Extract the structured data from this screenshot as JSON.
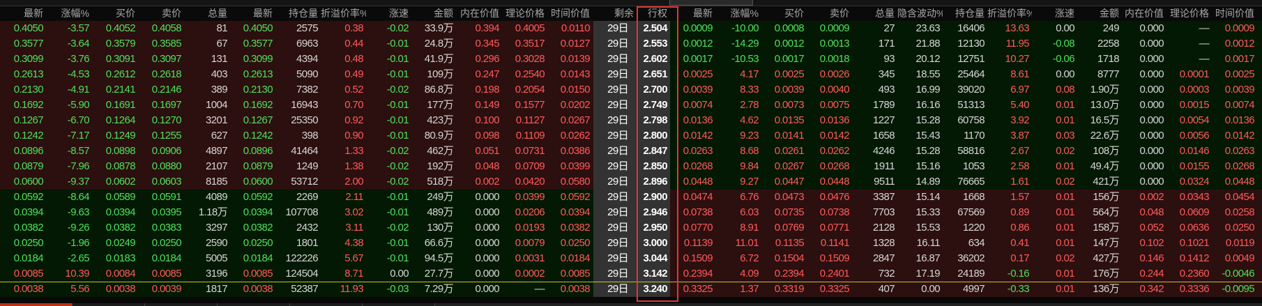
{
  "headers": {
    "call": [
      "最新",
      "涨幅%",
      "买价",
      "卖价",
      "总量",
      "最新",
      "持仓量",
      "折溢价率%",
      "涨速",
      "金额",
      "内在价值",
      "理论价格",
      "时间价值"
    ],
    "remaining": "剩余",
    "strike": "行权",
    "put": [
      "最新",
      "涨幅%",
      "买价",
      "卖价",
      "总量",
      "隐含波动%",
      "持仓量",
      "折溢价率%",
      "涨速",
      "金额",
      "内在价值",
      "理论价格",
      "时间价值"
    ]
  },
  "rows": [
    {
      "strike": "2.504",
      "days": "29日",
      "call": [
        "0.4050",
        "-3.57",
        "0.4052",
        "0.4058",
        "81",
        "0.4050",
        "2575",
        "0.38",
        "-0.02",
        "33.9万",
        "0.394",
        "0.4005",
        "0.0110"
      ],
      "put": [
        "0.0009",
        "-10.00",
        "0.0008",
        "0.0009",
        "27",
        "23.63",
        "16406",
        "13.63",
        "0.00",
        "249",
        "0.000",
        "—",
        "0.0009"
      ]
    },
    {
      "strike": "2.553",
      "days": "29日",
      "call": [
        "0.3577",
        "-3.64",
        "0.3579",
        "0.3585",
        "67",
        "0.3577",
        "6963",
        "0.44",
        "-0.01",
        "24.8万",
        "0.345",
        "0.3517",
        "0.0127"
      ],
      "put": [
        "0.0012",
        "-14.29",
        "0.0012",
        "0.0013",
        "171",
        "21.88",
        "12130",
        "11.95",
        "-0.08",
        "2258",
        "0.000",
        "—",
        "0.0012"
      ]
    },
    {
      "strike": "2.602",
      "days": "29日",
      "call": [
        "0.3099",
        "-3.76",
        "0.3091",
        "0.3097",
        "131",
        "0.3099",
        "4394",
        "0.48",
        "-0.01",
        "41.9万",
        "0.296",
        "0.3028",
        "0.0139"
      ],
      "put": [
        "0.0017",
        "-10.53",
        "0.0017",
        "0.0018",
        "93",
        "20.12",
        "12751",
        "10.27",
        "-0.06",
        "1718",
        "0.000",
        "—",
        "0.0017"
      ]
    },
    {
      "strike": "2.651",
      "days": "29日",
      "call": [
        "0.2613",
        "-4.53",
        "0.2612",
        "0.2618",
        "403",
        "0.2613",
        "5090",
        "0.49",
        "-0.01",
        "109万",
        "0.247",
        "0.2540",
        "0.0143"
      ],
      "put": [
        "0.0025",
        "4.17",
        "0.0025",
        "0.0026",
        "345",
        "18.55",
        "25464",
        "8.61",
        "0.00",
        "8777",
        "0.000",
        "0.0001",
        "0.0025"
      ]
    },
    {
      "strike": "2.700",
      "days": "29日",
      "call": [
        "0.2130",
        "-4.91",
        "0.2141",
        "0.2146",
        "389",
        "0.2130",
        "7382",
        "0.52",
        "-0.02",
        "86.8万",
        "0.198",
        "0.2054",
        "0.0150"
      ],
      "put": [
        "0.0039",
        "8.33",
        "0.0039",
        "0.0040",
        "493",
        "16.99",
        "39020",
        "6.97",
        "0.08",
        "1.90万",
        "0.000",
        "0.0003",
        "0.0039"
      ]
    },
    {
      "strike": "2.749",
      "days": "29日",
      "call": [
        "0.1692",
        "-5.90",
        "0.1691",
        "0.1697",
        "1004",
        "0.1692",
        "16943",
        "0.70",
        "-0.01",
        "177万",
        "0.149",
        "0.1577",
        "0.0202"
      ],
      "put": [
        "0.0074",
        "2.78",
        "0.0073",
        "0.0075",
        "1789",
        "16.16",
        "51313",
        "5.40",
        "0.01",
        "13.0万",
        "0.000",
        "0.0015",
        "0.0074"
      ]
    },
    {
      "strike": "2.798",
      "days": "29日",
      "call": [
        "0.1267",
        "-6.70",
        "0.1264",
        "0.1270",
        "3201",
        "0.1267",
        "25350",
        "0.92",
        "-0.01",
        "423万",
        "0.100",
        "0.1127",
        "0.0267"
      ],
      "put": [
        "0.0136",
        "4.62",
        "0.0135",
        "0.0136",
        "1227",
        "15.28",
        "60758",
        "3.92",
        "0.01",
        "16.5万",
        "0.000",
        "0.0054",
        "0.0136"
      ]
    },
    {
      "strike": "2.800",
      "days": "29日",
      "call": [
        "0.1242",
        "-7.17",
        "0.1249",
        "0.1255",
        "627",
        "0.1242",
        "398",
        "0.90",
        "-0.01",
        "80.9万",
        "0.098",
        "0.1109",
        "0.0262"
      ],
      "put": [
        "0.0142",
        "9.23",
        "0.0141",
        "0.0142",
        "1658",
        "15.43",
        "1170",
        "3.87",
        "0.03",
        "22.6万",
        "0.000",
        "0.0056",
        "0.0142"
      ]
    },
    {
      "strike": "2.847",
      "days": "29日",
      "call": [
        "0.0896",
        "-8.57",
        "0.0898",
        "0.0906",
        "4897",
        "0.0896",
        "41464",
        "1.33",
        "-0.02",
        "462万",
        "0.051",
        "0.0731",
        "0.0386"
      ],
      "put": [
        "0.0263",
        "8.68",
        "0.0261",
        "0.0262",
        "4246",
        "15.28",
        "58816",
        "2.67",
        "0.02",
        "108万",
        "0.000",
        "0.0146",
        "0.0263"
      ]
    },
    {
      "strike": "2.850",
      "days": "29日",
      "call": [
        "0.0879",
        "-7.96",
        "0.0878",
        "0.0880",
        "2107",
        "0.0879",
        "1249",
        "1.38",
        "-0.02",
        "192万",
        "0.048",
        "0.0709",
        "0.0399"
      ],
      "put": [
        "0.0268",
        "9.84",
        "0.0267",
        "0.0268",
        "1911",
        "15.16",
        "1053",
        "2.58",
        "0.01",
        "49.4万",
        "0.000",
        "0.0155",
        "0.0268"
      ]
    },
    {
      "strike": "2.896",
      "days": "29日",
      "call": [
        "0.0600",
        "-9.37",
        "0.0602",
        "0.0603",
        "8185",
        "0.0600",
        "53712",
        "2.00",
        "-0.02",
        "518万",
        "0.002",
        "0.0420",
        "0.0580"
      ],
      "put": [
        "0.0448",
        "9.27",
        "0.0447",
        "0.0448",
        "9511",
        "14.89",
        "76665",
        "1.61",
        "0.02",
        "421万",
        "0.000",
        "0.0324",
        "0.0448"
      ]
    },
    {
      "strike": "2.900",
      "days": "29日",
      "call": [
        "0.0592",
        "-8.64",
        "0.0589",
        "0.0591",
        "4089",
        "0.0592",
        "2269",
        "2.11",
        "-0.01",
        "249万",
        "0.000",
        "0.0399",
        "0.0592"
      ],
      "put": [
        "0.0474",
        "6.76",
        "0.0473",
        "0.0476",
        "3387",
        "15.14",
        "1668",
        "1.57",
        "0.01",
        "156万",
        "0.002",
        "0.0343",
        "0.0454"
      ]
    },
    {
      "strike": "2.946",
      "days": "29日",
      "call": [
        "0.0394",
        "-9.63",
        "0.0394",
        "0.0395",
        "1.18万",
        "0.0394",
        "107708",
        "3.02",
        "-0.01",
        "489万",
        "0.000",
        "0.0206",
        "0.0394"
      ],
      "put": [
        "0.0738",
        "6.03",
        "0.0735",
        "0.0738",
        "7703",
        "15.33",
        "67569",
        "0.89",
        "0.01",
        "564万",
        "0.048",
        "0.0609",
        "0.0258"
      ]
    },
    {
      "strike": "2.950",
      "days": "29日",
      "call": [
        "0.0382",
        "-9.26",
        "0.0382",
        "0.0383",
        "3297",
        "0.0382",
        "2432",
        "3.11",
        "-0.02",
        "130万",
        "0.000",
        "0.0193",
        "0.0382"
      ],
      "put": [
        "0.0770",
        "8.91",
        "0.0769",
        "0.0771",
        "2128",
        "15.53",
        "1220",
        "0.86",
        "0.01",
        "158万",
        "0.052",
        "0.0636",
        "0.0250"
      ]
    },
    {
      "strike": "3.000",
      "days": "29日",
      "call": [
        "0.0250",
        "-1.96",
        "0.0249",
        "0.0250",
        "2590",
        "0.0250",
        "1801",
        "4.38",
        "-0.01",
        "66.6万",
        "0.000",
        "0.0079",
        "0.0250"
      ],
      "put": [
        "0.1139",
        "11.01",
        "0.1135",
        "0.1141",
        "1328",
        "16.11",
        "634",
        "0.41",
        "0.01",
        "147万",
        "0.102",
        "0.1021",
        "0.0119"
      ]
    },
    {
      "strike": "3.044",
      "days": "29日",
      "call": [
        "0.0184",
        "-2.65",
        "0.0183",
        "0.0184",
        "5005",
        "0.0184",
        "122226",
        "5.67",
        "-0.01",
        "94.5万",
        "0.000",
        "0.0031",
        "0.0184"
      ],
      "put": [
        "0.1509",
        "6.72",
        "0.1504",
        "0.1509",
        "2847",
        "16.87",
        "36202",
        "0.17",
        "0.02",
        "427万",
        "0.146",
        "0.1412",
        "0.0049"
      ]
    },
    {
      "strike": "3.142",
      "days": "29日",
      "call": [
        "0.0085",
        "10.39",
        "0.0084",
        "0.0085",
        "3196",
        "0.0085",
        "124504",
        "8.71",
        "0.00",
        "27.7万",
        "0.000",
        "0.0002",
        "0.0085"
      ],
      "put": [
        "0.2394",
        "4.09",
        "0.2394",
        "0.2401",
        "732",
        "17.19",
        "24189",
        "-0.16",
        "0.01",
        "176万",
        "0.244",
        "0.2360",
        "-0.0046"
      ]
    },
    {
      "strike": "3.240",
      "days": "29日",
      "call": [
        "0.0038",
        "5.56",
        "0.0038",
        "0.0039",
        "1817",
        "0.0038",
        "52387",
        "11.93",
        "-0.03",
        "7.29万",
        "0.000",
        "—",
        "0.0038"
      ],
      "put": [
        "0.3325",
        "1.37",
        "0.3319",
        "0.3325",
        "407",
        "0.00",
        "4997",
        "-0.33",
        "0.01",
        "136万",
        "0.342",
        "0.3336",
        "-0.0095"
      ]
    }
  ]
}
